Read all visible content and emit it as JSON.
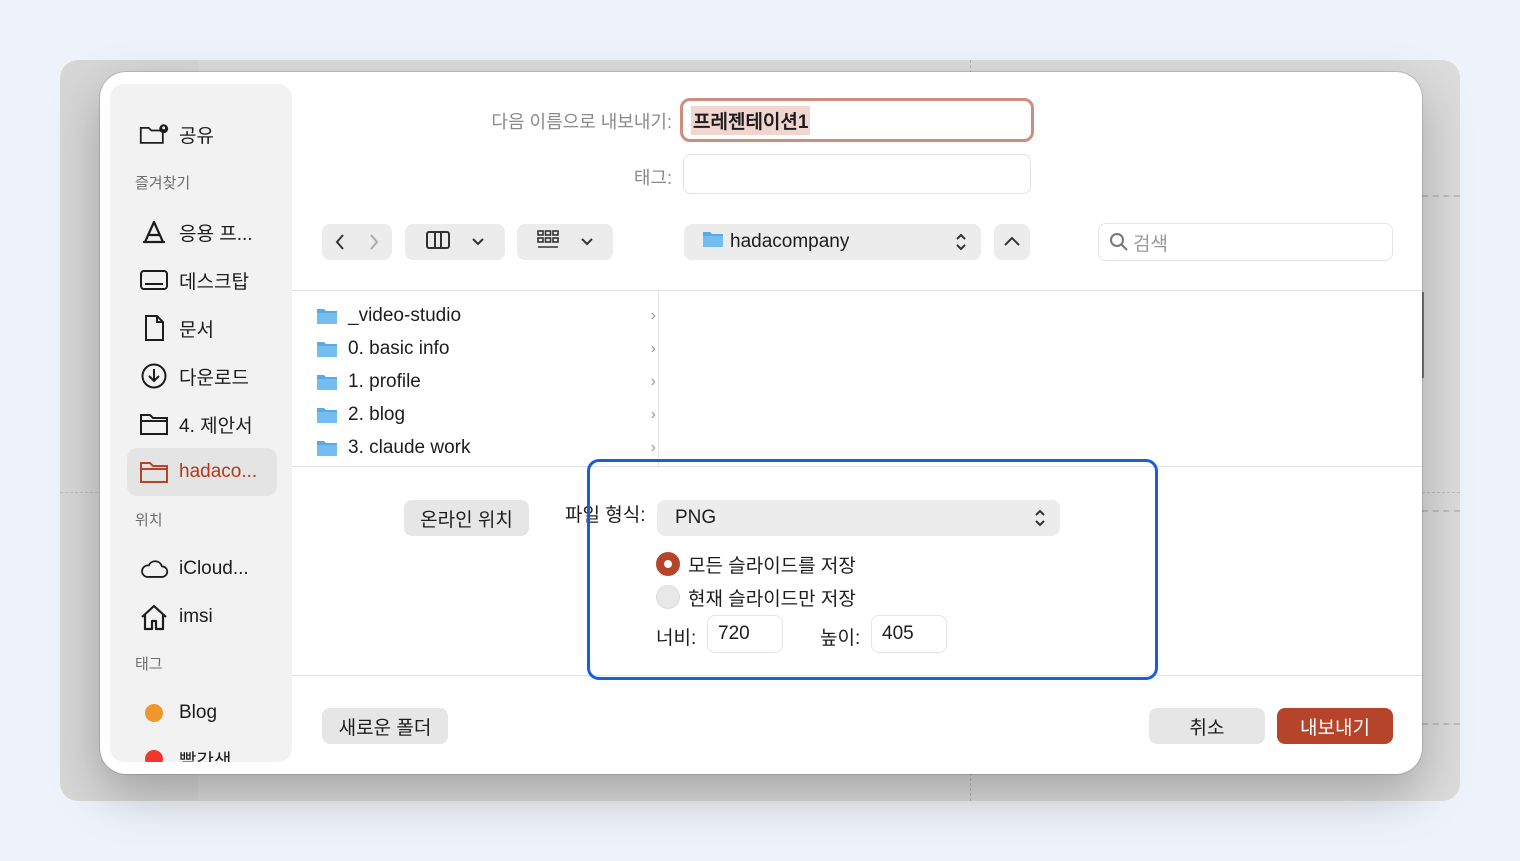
{
  "dialog": {
    "export_as_label": "다음 이름으로 내보내기:",
    "file_name": "프레젠테이션1",
    "tags_label": "태그:",
    "tags_value": ""
  },
  "sidebar": {
    "share_label": "공유",
    "favorites_header": "즐겨찾기",
    "favorites": [
      {
        "label": "응용 프...",
        "icon": "apps-icon"
      },
      {
        "label": "데스크탑",
        "icon": "desktop-icon"
      },
      {
        "label": "문서",
        "icon": "document-icon"
      },
      {
        "label": "다운로드",
        "icon": "download-icon"
      },
      {
        "label": "4. 제안서",
        "icon": "folder-icon"
      },
      {
        "label": "hadaco...",
        "icon": "folder-icon",
        "active": true
      }
    ],
    "locations_header": "위치",
    "locations": [
      {
        "label": "iCloud...",
        "icon": "cloud-icon"
      },
      {
        "label": "imsi",
        "icon": "home-icon"
      }
    ],
    "tags_header": "태그",
    "tags": [
      {
        "label": "Blog",
        "color": "#f0962a"
      },
      {
        "label": "빨간색",
        "color": "#f0352c"
      }
    ]
  },
  "toolbar": {
    "location": "hadacompany",
    "search_placeholder": "검색"
  },
  "files": [
    {
      "name": "_video-studio"
    },
    {
      "name": "0. basic info"
    },
    {
      "name": "1. profile"
    },
    {
      "name": "2. blog"
    },
    {
      "name": "3. claude work"
    }
  ],
  "options": {
    "online_location_button": "온라인 위치",
    "file_format_label": "파일 형식:",
    "file_format_value": "PNG",
    "radio_all": "모든 슬라이드를 저장",
    "radio_current": "현재 슬라이드만 저장",
    "width_label": "너비:",
    "width_value": "720",
    "height_label": "높이:",
    "height_value": "405"
  },
  "footer": {
    "new_folder": "새로운 폴더",
    "cancel": "취소",
    "export": "내보내기"
  },
  "colors": {
    "accent": "#b5442a",
    "highlight": "#1a5fd8",
    "folder": "#5aa9e6"
  }
}
